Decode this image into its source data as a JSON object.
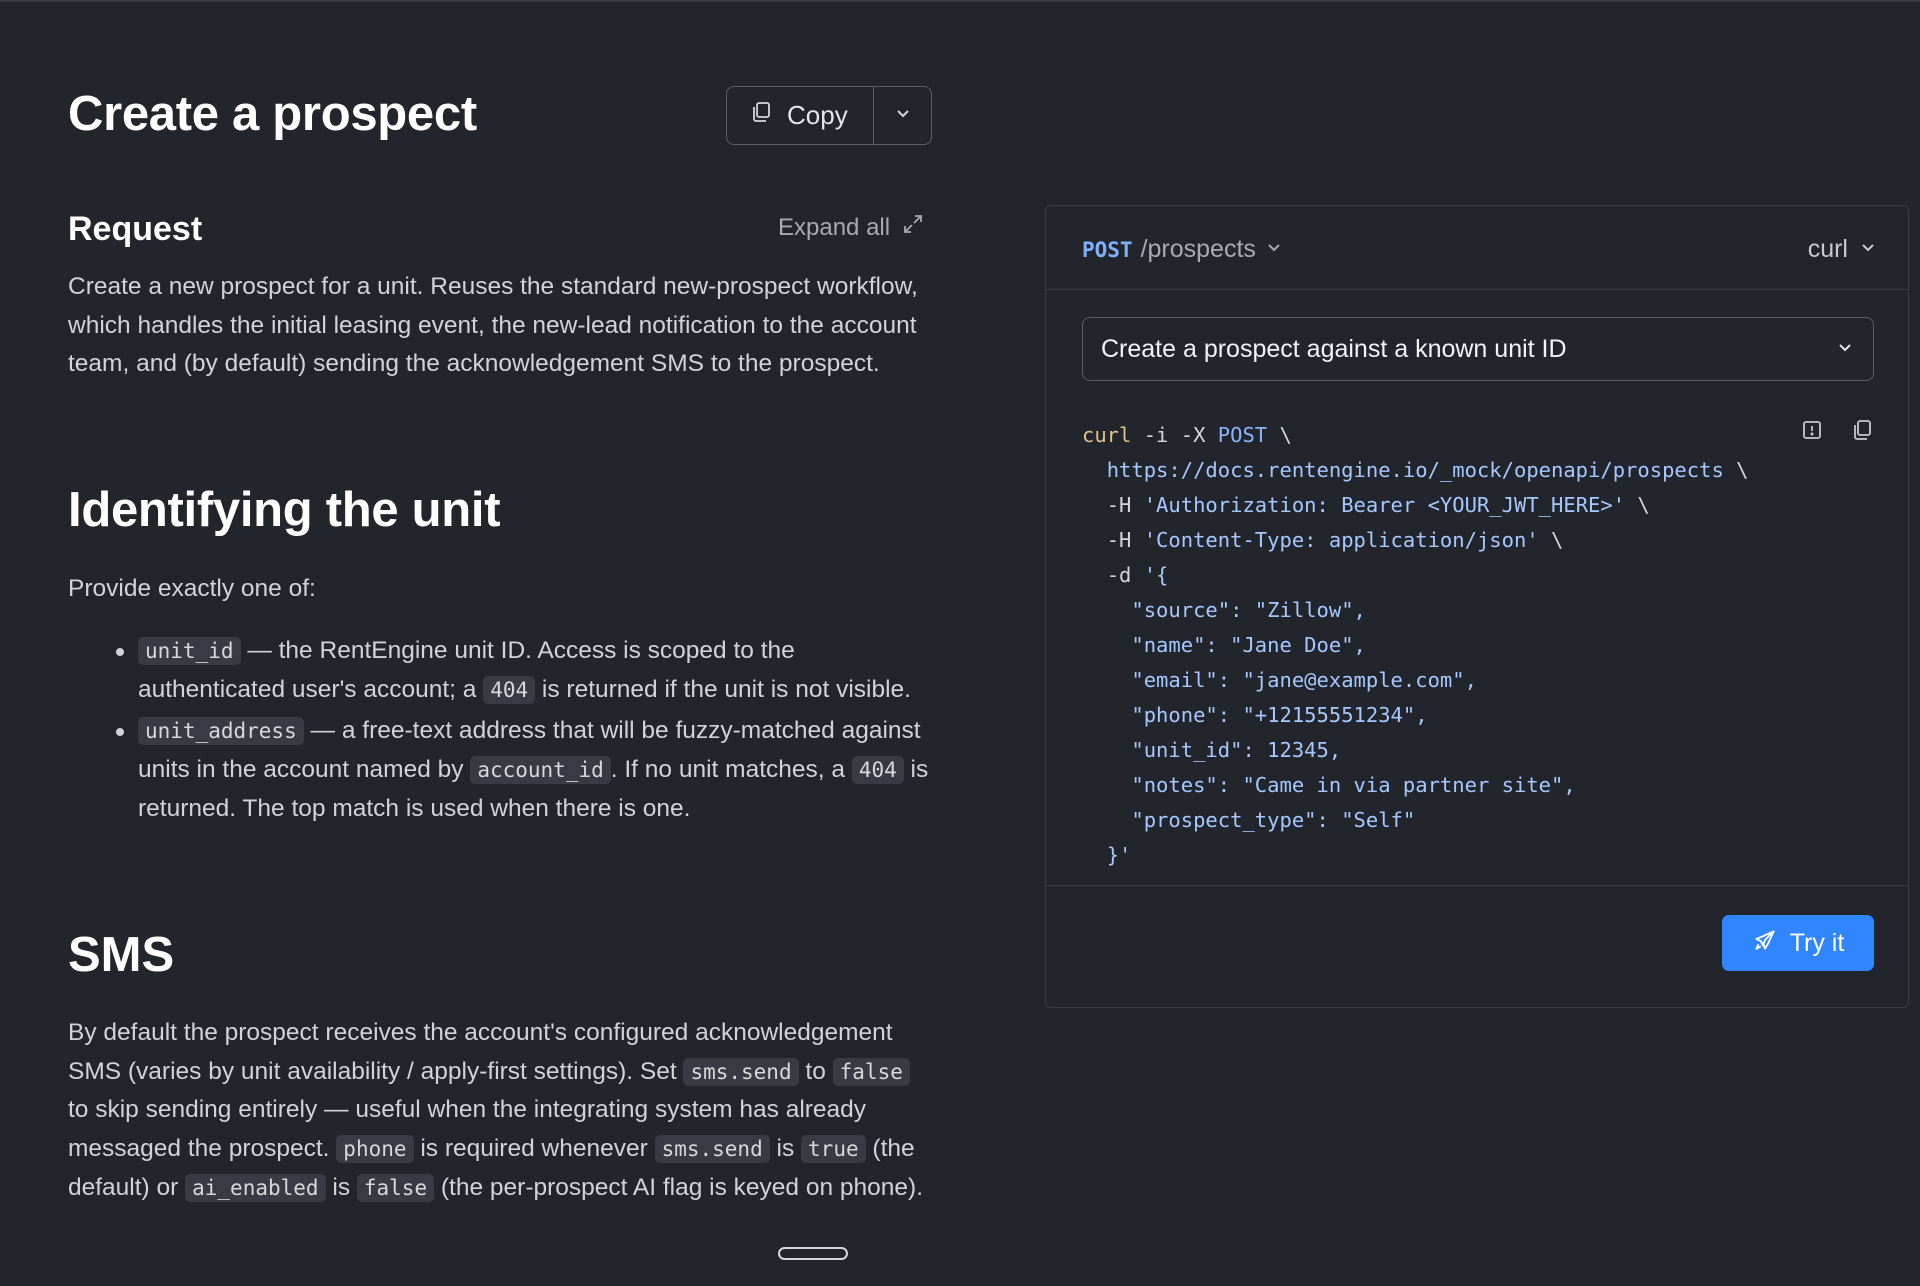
{
  "page": {
    "title": "Create a prospect",
    "copy_label": "Copy"
  },
  "request": {
    "heading": "Request",
    "expand_all": "Expand all",
    "description": "Create a new prospect for a unit. Reuses the standard new-prospect workflow, which handles the initial leasing event, the new-lead notification to the account team, and (by default) sending the acknowledgement SMS to the prospect."
  },
  "identifying": {
    "heading": "Identifying the unit",
    "intro": "Provide exactly one of:",
    "bullets": [
      {
        "code": "unit_id",
        "text_1": " — the RentEngine unit ID. Access is scoped to the authenticated user's account; a ",
        "code_2": "404",
        "text_2": " is returned if the unit is not visible."
      },
      {
        "code": "unit_address",
        "text_1": " — a free-text address that will be fuzzy-matched against units in the account named by ",
        "code_2": "account_id",
        "text_2": ". If no unit matches, a ",
        "code_3": "404",
        "text_3": " is returned. The top match is used when there is one."
      }
    ]
  },
  "sms": {
    "heading": "SMS",
    "t1": "By default the prospect receives the account's configured acknowledgement SMS (varies by unit availability / apply-first settings). Set ",
    "c1": "sms.send",
    "t2": " to ",
    "c2": "false",
    "t3": " to skip sending entirely — useful when the integrating system has already messaged the prospect. ",
    "c3": "phone",
    "t4": " is required whenever ",
    "c4": "sms.send",
    "t5": " is ",
    "c5": "true",
    "t6": " (the default) or ",
    "c6": "ai_enabled",
    "t7": " is ",
    "c7": "false",
    "t8": " (the per-prospect AI flag is keyed on phone)."
  },
  "panel": {
    "method": "POST",
    "path": "/prospects",
    "language": "curl",
    "example": "Create a prospect against a known unit ID",
    "code": {
      "l1_cmd": "curl",
      "l1_rest": " -i -X ",
      "l1_kw": "POST",
      "l1_tail": " \\",
      "l2_url": "https://docs.rentengine.io/_mock/openapi/prospects",
      "l2_tail": " \\",
      "l3_flag": "-H ",
      "l3_str": "'Authorization: Bearer <YOUR_JWT_HERE>'",
      "l3_tail": " \\",
      "l4_flag": "-H ",
      "l4_str": "'Content-Type: application/json'",
      "l4_tail": " \\",
      "l5_flag": "-d ",
      "l5_str": "'{",
      "body": [
        "\"source\": \"Zillow\",",
        "\"name\": \"Jane Doe\",",
        "\"email\": \"jane@example.com\",",
        "\"phone\": \"+12155551234\",",
        "\"unit_id\": 12345,",
        "\"notes\": \"Came in via partner site\",",
        "\"prospect_type\": \"Self\""
      ],
      "close": "}'"
    },
    "try_label": "Try it"
  },
  "colors": {
    "background": "#23252c",
    "accent_button": "#2f86ff",
    "method": "#7fb0ff"
  },
  "icons": [
    "copy-icon",
    "chevron-down-icon",
    "expand-icon",
    "report-icon",
    "clipboard-icon",
    "rocket-icon"
  ]
}
